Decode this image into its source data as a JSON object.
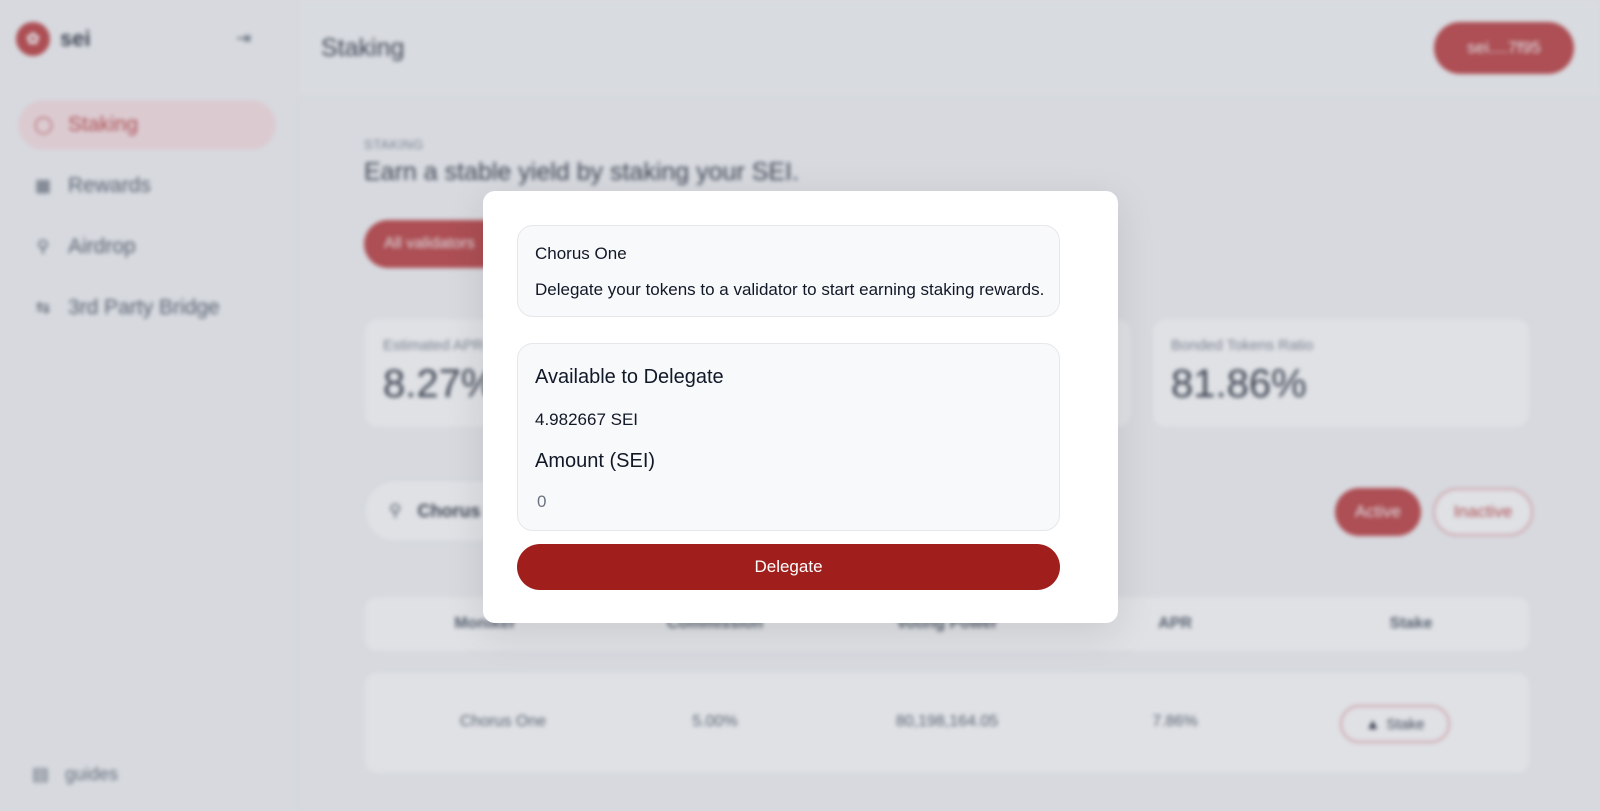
{
  "app": {
    "logo_text": "sei",
    "logo_icon": "sei-logo-icon",
    "collapse_icon": "sidebar-collapse-icon",
    "accent": "#b5282a"
  },
  "sidebar": {
    "items": [
      {
        "label": "Staking",
        "icon": "coins-icon",
        "active": true
      },
      {
        "label": "Rewards",
        "icon": "gift-icon",
        "active": false
      },
      {
        "label": "Airdrop",
        "icon": "parachute-icon",
        "active": false
      },
      {
        "label": "3rd Party Bridge",
        "icon": "swap-arrows-icon",
        "active": false
      }
    ],
    "footer_label": "guides"
  },
  "header": {
    "title": "Staking",
    "wallet_label": "sei....7f95"
  },
  "main": {
    "eyebrow": "STAKING",
    "headline": "Earn a stable yield by staking your SEI.",
    "filter_label": "All validators",
    "stats": [
      {
        "label": "Estimated APR",
        "value": "8.27%"
      },
      {
        "label": "Bonded Tokens Ratio",
        "value": "81.86%"
      }
    ],
    "search_value": "Chorus",
    "toggle_active": "Active",
    "toggle_inactive": "Inactive",
    "table": {
      "columns": [
        "Moniker",
        "Commission",
        "Voting Power",
        "APR",
        "Stake"
      ],
      "rows": [
        {
          "moniker": "Chorus One",
          "commission": "5.00%",
          "voting_power": "80,198,164.05",
          "apr": "7.86%",
          "action": "Stake"
        }
      ]
    }
  },
  "modal": {
    "validator_name": "Chorus One",
    "info_text": "Delegate your tokens to a validator to start earning staking rewards.",
    "available_label": "Available to Delegate",
    "available_value": "4.982667 SEI",
    "amount_label": "Amount (SEI)",
    "amount_placeholder": "0",
    "amount_value": "",
    "delegate_label": "Delegate",
    "button_color": "#a01f1d"
  }
}
